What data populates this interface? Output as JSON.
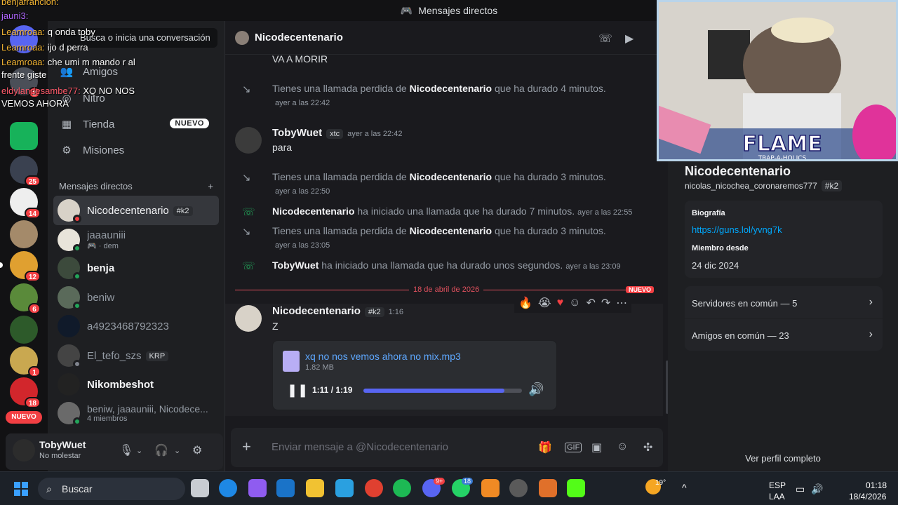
{
  "window": {
    "title": "Mensajes directos"
  },
  "overlay_chat": [
    {
      "user": "benjafrancion:",
      "text": "",
      "color": "#f0b232"
    },
    {
      "user": "jauni3:",
      "text": "",
      "color": "#b066ff"
    },
    {
      "user": "Leamroaa:",
      "text": "q onda toby",
      "color": "#f0b232"
    },
    {
      "user": "Leamroaa:",
      "text": "ijo d perra",
      "color": "#f0b232"
    },
    {
      "user": "Leamroaa:",
      "text": "che umi m mando r al frente giste",
      "color": "#f0b232"
    },
    {
      "user": "eldylandesambe77:",
      "text": "XQ NO NOS VEMOS AHORA",
      "color": "#ff5a6a"
    }
  ],
  "sidebar": {
    "search_placeholder": "Busca o inicia una conversación",
    "nav": [
      {
        "label": "Amigos",
        "icon": "friends-icon"
      },
      {
        "label": "Nitro",
        "icon": "nitro-icon"
      },
      {
        "label": "Tienda",
        "icon": "store-icon",
        "badge": "NUEVO"
      },
      {
        "label": "Misiones",
        "icon": "quests-icon"
      }
    ],
    "dm_header": "Mensajes directos",
    "dms": [
      {
        "name": "Nicodecentenario",
        "tag": "#k2",
        "sub": "",
        "status": "#f23f43"
      },
      {
        "name": "jaaauniii",
        "tag": "",
        "sub": "🎮 · dem",
        "status": "#23a55a"
      },
      {
        "name": "benja",
        "tag": "",
        "sub": "",
        "status": "#23a55a"
      },
      {
        "name": "beniw",
        "tag": "",
        "sub": "",
        "status": "#23a55a"
      },
      {
        "name": "a4923468792323",
        "tag": "",
        "sub": "",
        "status": ""
      },
      {
        "name": "El_tefo_szs",
        "tag": "KRP",
        "sub": "",
        "status": "#80848e"
      },
      {
        "name": "Nikombeshot",
        "tag": "",
        "sub": "",
        "status": ""
      },
      {
        "name": "beniw, jaaauniii, Nicodece...",
        "tag": "",
        "sub": "4 miembros",
        "status": "#23a55a"
      }
    ]
  },
  "rail": {
    "badges": [
      "2",
      "25",
      "14",
      "12",
      "6",
      "1",
      "18"
    ],
    "nuevo": "NUEVO"
  },
  "user_panel": {
    "name": "TobyWuet",
    "status": "No molestar"
  },
  "chat": {
    "header_name": "Nicodecentenario",
    "messages": {
      "top_text": "VA A MORIR",
      "missed1": {
        "pre": "Tienes una llamada perdida de ",
        "who": "Nicodecentenario",
        "post": " que ha durado 4 minutos.",
        "time": "ayer a las 22:42"
      },
      "toby_author": "TobyWuet",
      "toby_tag": "xtc",
      "toby_time": "ayer a las 22:42",
      "toby_text": "para",
      "missed2": {
        "pre": "Tienes una llamada perdida de ",
        "who": "Nicodecentenario",
        "post": " que ha durado 3 minutos.",
        "time": "ayer a las 22:50"
      },
      "call1": {
        "who": "Nicodecentenario",
        "post": " ha iniciado una llamada que ha durado 7 minutos.",
        "time": "ayer a las 22:55"
      },
      "missed3": {
        "pre": "Tienes una llamada perdida de ",
        "who": "Nicodecentenario",
        "post": " que ha durado 3 minutos.",
        "time": "ayer a las 23:05"
      },
      "call2": {
        "who": "TobyWuet",
        "post": " ha iniciado una llamada que ha durado unos segundos.",
        "time": "ayer a las 23:09"
      },
      "divider": "18 de abril de 2026",
      "divider_new": "NUEVO",
      "last_author": "Nicodecentenario",
      "last_tag": "#k2",
      "last_time": "1:16",
      "last_text": "Z"
    },
    "attachment": {
      "filename": "xq no nos vemos ahora no mix.mp3",
      "size": "1.82 MB",
      "time": "1:11 / 1:19",
      "progress": 0.89
    },
    "composer_placeholder": "Enviar mensaje a @Nicodecentenario"
  },
  "profile": {
    "name": "Nicodecentenario",
    "username": "nicolas_nicochea_coronaremos777",
    "tag": "#k2",
    "bio_label": "Biografía",
    "bio_link": "https://guns.lol/yvng7k",
    "member_label": "Miembro desde",
    "member_since": "24 dic 2024",
    "servers_common": "Servidores en común — 5",
    "friends_common": "Amigos en común — 23",
    "full_profile": "Ver perfil completo",
    "stream_banner": "FLAME",
    "stream_sub": "TRAP-A-HOLICS"
  },
  "taskbar": {
    "search": "Buscar",
    "weather": "19°",
    "lang1": "ESP",
    "lang2": "LAA",
    "time": "01:18",
    "date": "18/4/2026",
    "discord_badge": "9+",
    "whatsapp_badge": "18"
  }
}
